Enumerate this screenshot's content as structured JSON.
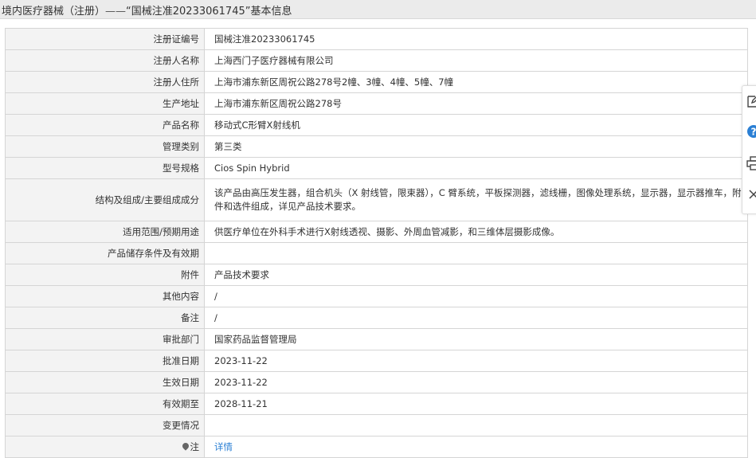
{
  "header": {
    "prefix": "境内医疗器械（注册）",
    "separator": "——",
    "suffix": "“国械注准20233061745”基本信息"
  },
  "rows": [
    {
      "label": "注册证编号",
      "value": "国械注准20233061745"
    },
    {
      "label": "注册人名称",
      "value": "上海西门子医疗器械有限公司"
    },
    {
      "label": "注册人住所",
      "value": "上海市浦东新区周祝公路278号2幢、3幢、4幢、5幢、7幢"
    },
    {
      "label": "生产地址",
      "value": "上海市浦东新区周祝公路278号"
    },
    {
      "label": "产品名称",
      "value": "移动式C形臂X射线机"
    },
    {
      "label": "管理类别",
      "value": "第三类"
    },
    {
      "label": "型号规格",
      "value": "Cios Spin Hybrid"
    },
    {
      "label": "结构及组成/主要组成成分",
      "value": "该产品由高压发生器，组合机头（X 射线管，限束器），C 臂系统，平板探测器，滤线栅，图像处理系统，显示器，显示器推车，附件和选件组成，详见产品技术要求。"
    },
    {
      "label": "适用范围/预期用途",
      "value": "供医疗单位在外科手术进行X射线透视、摄影、外周血管减影，和三维体层摄影成像。"
    },
    {
      "label": "产品储存条件及有效期",
      "value": ""
    },
    {
      "label": "附件",
      "value": "产品技术要求"
    },
    {
      "label": "其他内容",
      "value": "/"
    },
    {
      "label": "备注",
      "value": "/"
    },
    {
      "label": "审批部门",
      "value": "国家药品监督管理局"
    },
    {
      "label": "批准日期",
      "value": "2023-11-22"
    },
    {
      "label": "生效日期",
      "value": "2023-11-22"
    },
    {
      "label": "有效期至",
      "value": "2028-11-21"
    },
    {
      "label": "变更情况",
      "value": ""
    }
  ],
  "note": {
    "label": "注",
    "link": "详情"
  },
  "icons": {
    "note": "pin-icon",
    "side": [
      "edit-icon",
      "help-icon",
      "print-icon",
      "close-icon"
    ]
  },
  "colors": {
    "link": "#2a7fd4",
    "help": "#2a7fd4",
    "label_bg": "#f3f3f3",
    "header_bg": "#ebebeb"
  }
}
